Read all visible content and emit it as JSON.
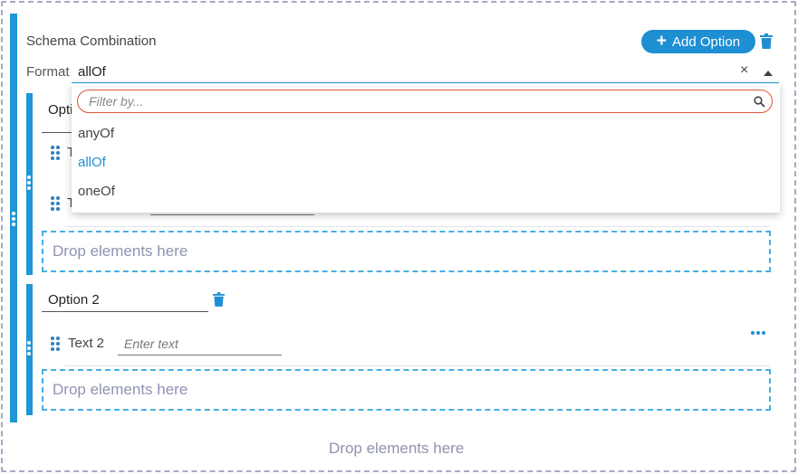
{
  "schema": {
    "title": "Schema Combination",
    "add_option_label": "Add Option",
    "format_label": "Format",
    "format_value": "allOf"
  },
  "dropdown": {
    "filter_placeholder": "Filter by...",
    "options": [
      {
        "label": "anyOf",
        "selected": false
      },
      {
        "label": "allOf",
        "selected": true
      },
      {
        "label": "oneOf",
        "selected": false
      }
    ]
  },
  "option1": {
    "name_partial": "Opti",
    "t_glyph": "T"
  },
  "option2": {
    "name": "Option 2",
    "field_label": "Text 2",
    "field_placeholder": "Enter text"
  },
  "dropzones": {
    "inner_label": "Drop elements here",
    "outer_label": "Drop elements here"
  },
  "colors": {
    "accent": "#1f96d6",
    "filter_border": "#e0533e",
    "dropzone_border": "#49aee2"
  }
}
